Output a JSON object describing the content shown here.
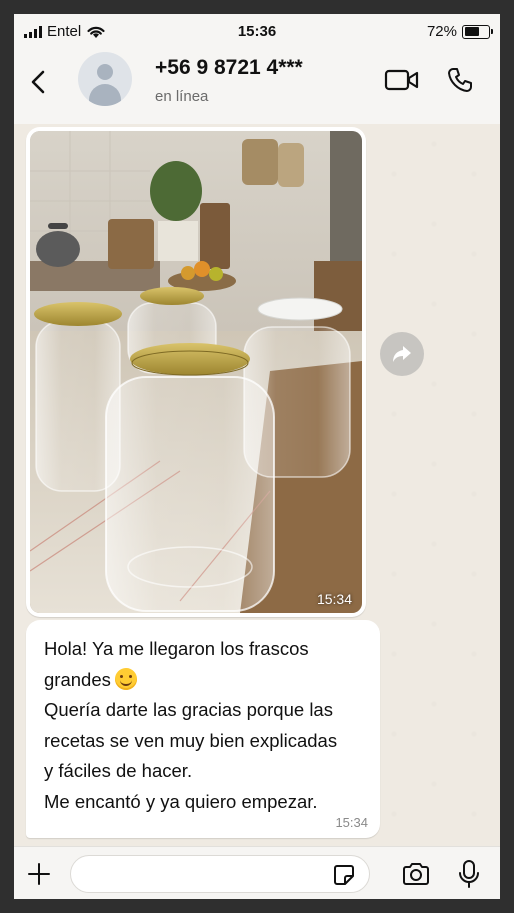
{
  "status_bar": {
    "carrier": "Entel",
    "time": "15:36",
    "battery": "72%",
    "battery_level": 0.72
  },
  "header": {
    "contact_name": "+56 9 8721 4***",
    "contact_status": "en línea",
    "icons": [
      "back-arrow-icon",
      "avatar-placeholder",
      "video-camera-icon",
      "phone-icon"
    ]
  },
  "messages": [
    {
      "type": "image",
      "time": "15:34",
      "image_description_icon": "photo-glass-jars"
    },
    {
      "type": "text",
      "time": "15:34",
      "lines": [
        "Hola! Ya me llegaron los frascos",
        "grandes",
        "Quería darte las gracias porque las",
        "recetas se ven muy bien explicadas",
        "y fáciles de hacer.",
        "Me encantó y ya quiero empezar."
      ],
      "emoji": "smiling-face-emoji"
    }
  ],
  "input_bar": {
    "placeholder": "",
    "icons": [
      "plus-icon",
      "sticker-icon",
      "camera-icon",
      "microphone-icon"
    ]
  },
  "colors": {
    "chat_background": "#efeae2",
    "bubble_incoming": "#ffffff",
    "header_background": "#f6f5f3"
  }
}
